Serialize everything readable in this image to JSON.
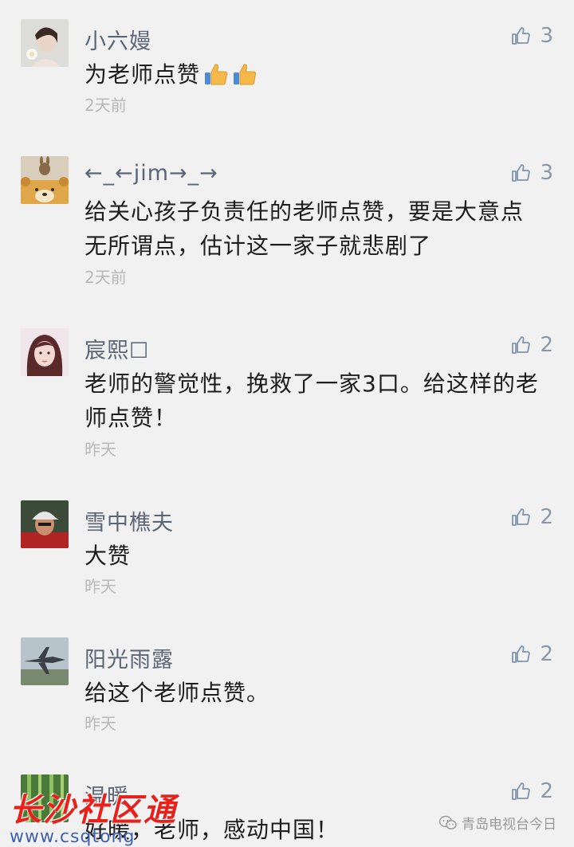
{
  "comments": [
    {
      "name": "小六嫚",
      "text": "为老师点赞",
      "emojis": 2,
      "likes": "3",
      "time": "2天前",
      "avatar": "woman-with-flower"
    },
    {
      "name": "←_←jim→_→",
      "text": "给关心孩子负责任的老师点赞，要是大意点无所谓点，估计这一家子就悲剧了",
      "likes": "3",
      "time": "2天前",
      "avatar": "rabbit-on-bear"
    },
    {
      "name": "宸熙☐",
      "text": "老师的警觉性，挽救了一家3口。给这样的老师点赞！",
      "likes": "2",
      "time": "昨天",
      "avatar": "girl-portrait"
    },
    {
      "name": "雪中樵夫",
      "text": "大赞",
      "likes": "2",
      "time": "昨天",
      "avatar": "man-in-cap"
    },
    {
      "name": "阳光雨露",
      "text": "给这个老师点赞。",
      "likes": "2",
      "time": "昨天",
      "avatar": "fighter-jet"
    },
    {
      "name": "温暖",
      "text": "好暖，老师，感动中国！",
      "likes": "2",
      "time": "",
      "avatar": "bamboo-forest"
    }
  ],
  "watermark": {
    "left_text": "长沙社区通",
    "left_url": "www.csqtong",
    "right_text": "青岛电视台今日"
  },
  "colors": {
    "background": "#f1f1f1",
    "name": "#5a6575",
    "like": "#8a99a8",
    "time": "#b8b8b8"
  }
}
